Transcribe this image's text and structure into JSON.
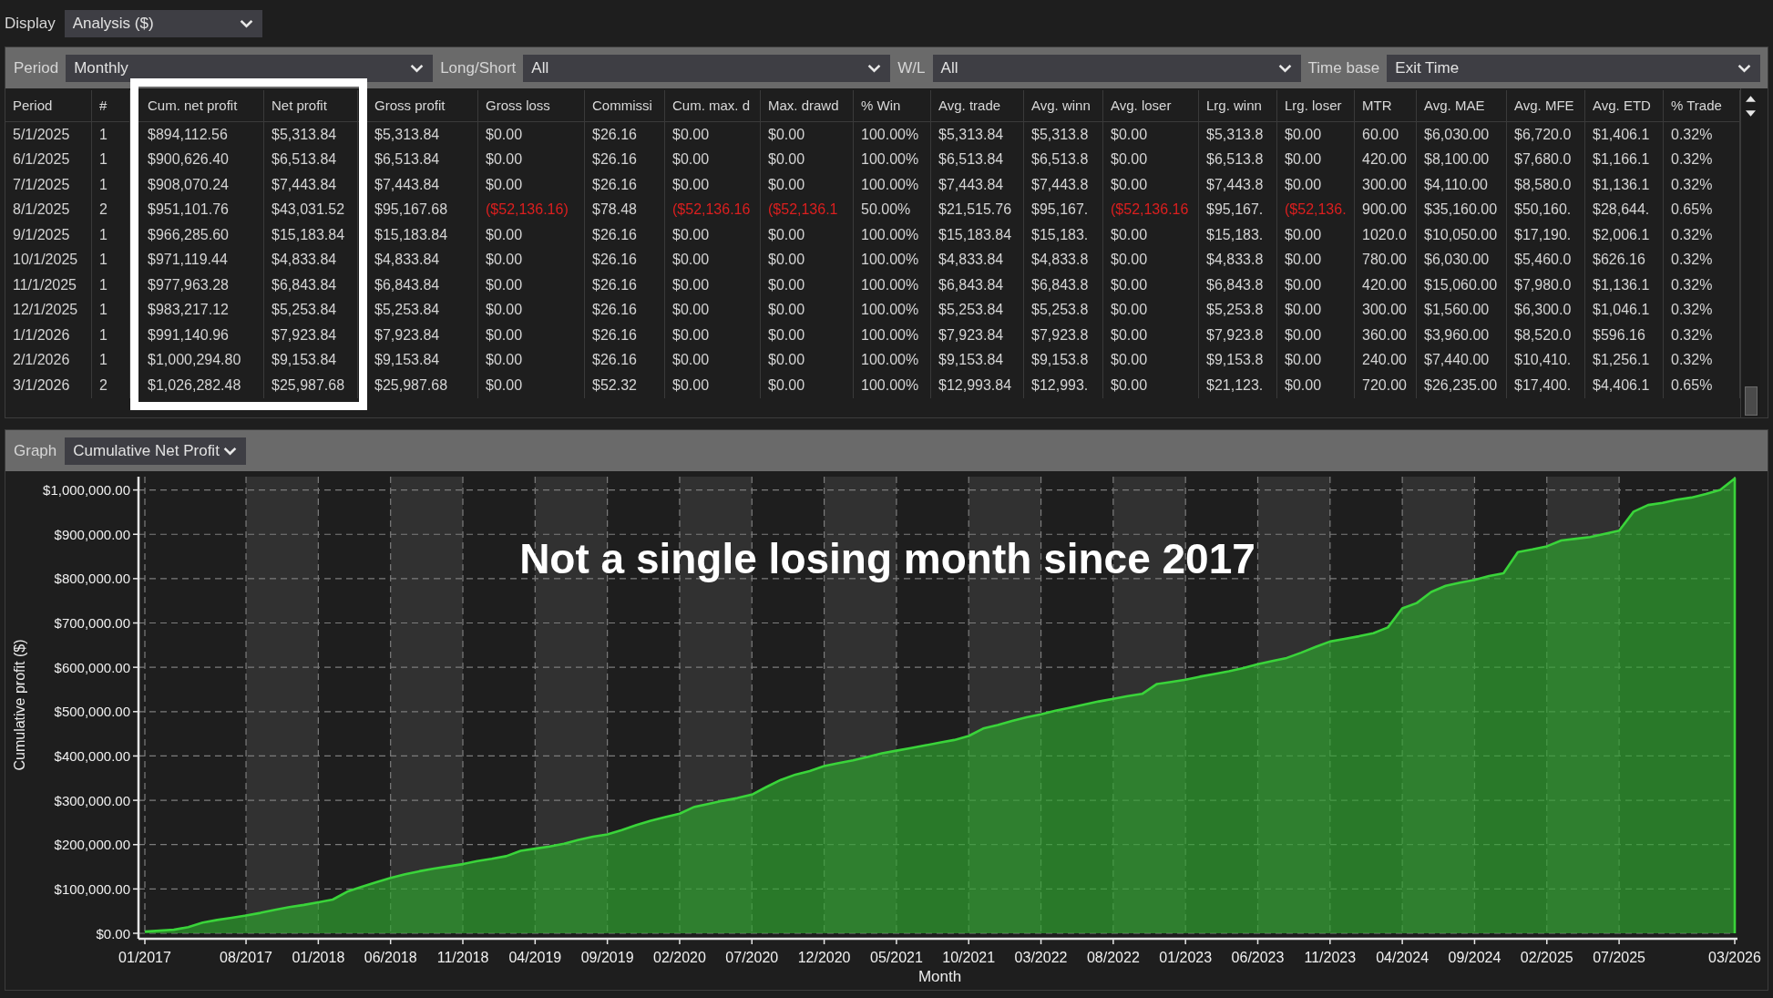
{
  "display": {
    "label": "Display",
    "value": "Analysis ($)"
  },
  "filters": [
    {
      "label": "Period",
      "value": "Monthly"
    },
    {
      "label": "Long/Short",
      "value": "All"
    },
    {
      "label": "W/L",
      "value": "All"
    },
    {
      "label": "Time base",
      "value": "Exit Time"
    }
  ],
  "table": {
    "columns": [
      {
        "label": "Period",
        "highlighted": false
      },
      {
        "label": "#",
        "highlighted": false
      },
      {
        "label": "Cum. net profit",
        "highlighted": true
      },
      {
        "label": "Net profit",
        "highlighted": true
      },
      {
        "label": "Gross profit",
        "highlighted": false
      },
      {
        "label": "Gross loss",
        "highlighted": false
      },
      {
        "label": "Commissi",
        "highlighted": false
      },
      {
        "label": "Cum. max. d",
        "highlighted": false
      },
      {
        "label": "Max. drawd",
        "highlighted": false
      },
      {
        "label": "% Win",
        "highlighted": false
      },
      {
        "label": "Avg. trade",
        "highlighted": false
      },
      {
        "label": "Avg. winn",
        "highlighted": false
      },
      {
        "label": "Avg. loser",
        "highlighted": false
      },
      {
        "label": "Lrg. winn",
        "highlighted": false
      },
      {
        "label": "Lrg. loser",
        "highlighted": false
      },
      {
        "label": "MTR",
        "highlighted": false
      },
      {
        "label": "Avg. MAE",
        "highlighted": false
      },
      {
        "label": "Avg. MFE",
        "highlighted": false
      },
      {
        "label": "Avg. ETD",
        "highlighted": false
      },
      {
        "label": "% Trade",
        "highlighted": false
      }
    ],
    "rows": [
      {
        "cells": [
          {
            "text": "5/1/2025",
            "negative": false
          },
          {
            "text": "1",
            "negative": false
          },
          {
            "text": "$894,112.56",
            "negative": false
          },
          {
            "text": "$5,313.84",
            "negative": false
          },
          {
            "text": "$5,313.84",
            "negative": false
          },
          {
            "text": "$0.00",
            "negative": false
          },
          {
            "text": "$26.16",
            "negative": false
          },
          {
            "text": "$0.00",
            "negative": false
          },
          {
            "text": "$0.00",
            "negative": false
          },
          {
            "text": "100.00%",
            "negative": false
          },
          {
            "text": "$5,313.84",
            "negative": false
          },
          {
            "text": "$5,313.8",
            "negative": false
          },
          {
            "text": "$0.00",
            "negative": false
          },
          {
            "text": "$5,313.8",
            "negative": false
          },
          {
            "text": "$0.00",
            "negative": false
          },
          {
            "text": "60.00",
            "negative": false
          },
          {
            "text": "$6,030.00",
            "negative": false
          },
          {
            "text": "$6,720.0",
            "negative": false
          },
          {
            "text": "$1,406.1",
            "negative": false
          },
          {
            "text": "0.32%",
            "negative": false
          }
        ]
      },
      {
        "cells": [
          {
            "text": "6/1/2025",
            "negative": false
          },
          {
            "text": "1",
            "negative": false
          },
          {
            "text": "$900,626.40",
            "negative": false
          },
          {
            "text": "$6,513.84",
            "negative": false
          },
          {
            "text": "$6,513.84",
            "negative": false
          },
          {
            "text": "$0.00",
            "negative": false
          },
          {
            "text": "$26.16",
            "negative": false
          },
          {
            "text": "$0.00",
            "negative": false
          },
          {
            "text": "$0.00",
            "negative": false
          },
          {
            "text": "100.00%",
            "negative": false
          },
          {
            "text": "$6,513.84",
            "negative": false
          },
          {
            "text": "$6,513.8",
            "negative": false
          },
          {
            "text": "$0.00",
            "negative": false
          },
          {
            "text": "$6,513.8",
            "negative": false
          },
          {
            "text": "$0.00",
            "negative": false
          },
          {
            "text": "420.00",
            "negative": false
          },
          {
            "text": "$8,100.00",
            "negative": false
          },
          {
            "text": "$7,680.0",
            "negative": false
          },
          {
            "text": "$1,166.1",
            "negative": false
          },
          {
            "text": "0.32%",
            "negative": false
          }
        ]
      },
      {
        "cells": [
          {
            "text": "7/1/2025",
            "negative": false
          },
          {
            "text": "1",
            "negative": false
          },
          {
            "text": "$908,070.24",
            "negative": false
          },
          {
            "text": "$7,443.84",
            "negative": false
          },
          {
            "text": "$7,443.84",
            "negative": false
          },
          {
            "text": "$0.00",
            "negative": false
          },
          {
            "text": "$26.16",
            "negative": false
          },
          {
            "text": "$0.00",
            "negative": false
          },
          {
            "text": "$0.00",
            "negative": false
          },
          {
            "text": "100.00%",
            "negative": false
          },
          {
            "text": "$7,443.84",
            "negative": false
          },
          {
            "text": "$7,443.8",
            "negative": false
          },
          {
            "text": "$0.00",
            "negative": false
          },
          {
            "text": "$7,443.8",
            "negative": false
          },
          {
            "text": "$0.00",
            "negative": false
          },
          {
            "text": "300.00",
            "negative": false
          },
          {
            "text": "$4,110.00",
            "negative": false
          },
          {
            "text": "$8,580.0",
            "negative": false
          },
          {
            "text": "$1,136.1",
            "negative": false
          },
          {
            "text": "0.32%",
            "negative": false
          }
        ]
      },
      {
        "cells": [
          {
            "text": "8/1/2025",
            "negative": false
          },
          {
            "text": "2",
            "negative": false
          },
          {
            "text": "$951,101.76",
            "negative": false
          },
          {
            "text": "$43,031.52",
            "negative": false
          },
          {
            "text": "$95,167.68",
            "negative": false
          },
          {
            "text": "($52,136.16)",
            "negative": true
          },
          {
            "text": "$78.48",
            "negative": false
          },
          {
            "text": "($52,136.16",
            "negative": true
          },
          {
            "text": "($52,136.1",
            "negative": true
          },
          {
            "text": "50.00%",
            "negative": false
          },
          {
            "text": "$21,515.76",
            "negative": false
          },
          {
            "text": "$95,167.",
            "negative": false
          },
          {
            "text": "($52,136.16",
            "negative": true
          },
          {
            "text": "$95,167.",
            "negative": false
          },
          {
            "text": "($52,136.",
            "negative": true
          },
          {
            "text": "900.00",
            "negative": false
          },
          {
            "text": "$35,160.00",
            "negative": false
          },
          {
            "text": "$50,160.",
            "negative": false
          },
          {
            "text": "$28,644.",
            "negative": false
          },
          {
            "text": "0.65%",
            "negative": false
          }
        ]
      },
      {
        "cells": [
          {
            "text": "9/1/2025",
            "negative": false
          },
          {
            "text": "1",
            "negative": false
          },
          {
            "text": "$966,285.60",
            "negative": false
          },
          {
            "text": "$15,183.84",
            "negative": false
          },
          {
            "text": "$15,183.84",
            "negative": false
          },
          {
            "text": "$0.00",
            "negative": false
          },
          {
            "text": "$26.16",
            "negative": false
          },
          {
            "text": "$0.00",
            "negative": false
          },
          {
            "text": "$0.00",
            "negative": false
          },
          {
            "text": "100.00%",
            "negative": false
          },
          {
            "text": "$15,183.84",
            "negative": false
          },
          {
            "text": "$15,183.",
            "negative": false
          },
          {
            "text": "$0.00",
            "negative": false
          },
          {
            "text": "$15,183.",
            "negative": false
          },
          {
            "text": "$0.00",
            "negative": false
          },
          {
            "text": "1020.0",
            "negative": false
          },
          {
            "text": "$10,050.00",
            "negative": false
          },
          {
            "text": "$17,190.",
            "negative": false
          },
          {
            "text": "$2,006.1",
            "negative": false
          },
          {
            "text": "0.32%",
            "negative": false
          }
        ]
      },
      {
        "cells": [
          {
            "text": "10/1/2025",
            "negative": false
          },
          {
            "text": "1",
            "negative": false
          },
          {
            "text": "$971,119.44",
            "negative": false
          },
          {
            "text": "$4,833.84",
            "negative": false
          },
          {
            "text": "$4,833.84",
            "negative": false
          },
          {
            "text": "$0.00",
            "negative": false
          },
          {
            "text": "$26.16",
            "negative": false
          },
          {
            "text": "$0.00",
            "negative": false
          },
          {
            "text": "$0.00",
            "negative": false
          },
          {
            "text": "100.00%",
            "negative": false
          },
          {
            "text": "$4,833.84",
            "negative": false
          },
          {
            "text": "$4,833.8",
            "negative": false
          },
          {
            "text": "$0.00",
            "negative": false
          },
          {
            "text": "$4,833.8",
            "negative": false
          },
          {
            "text": "$0.00",
            "negative": false
          },
          {
            "text": "780.00",
            "negative": false
          },
          {
            "text": "$6,030.00",
            "negative": false
          },
          {
            "text": "$5,460.0",
            "negative": false
          },
          {
            "text": "$626.16",
            "negative": false
          },
          {
            "text": "0.32%",
            "negative": false
          }
        ]
      },
      {
        "cells": [
          {
            "text": "11/1/2025",
            "negative": false
          },
          {
            "text": "1",
            "negative": false
          },
          {
            "text": "$977,963.28",
            "negative": false
          },
          {
            "text": "$6,843.84",
            "negative": false
          },
          {
            "text": "$6,843.84",
            "negative": false
          },
          {
            "text": "$0.00",
            "negative": false
          },
          {
            "text": "$26.16",
            "negative": false
          },
          {
            "text": "$0.00",
            "negative": false
          },
          {
            "text": "$0.00",
            "negative": false
          },
          {
            "text": "100.00%",
            "negative": false
          },
          {
            "text": "$6,843.84",
            "negative": false
          },
          {
            "text": "$6,843.8",
            "negative": false
          },
          {
            "text": "$0.00",
            "negative": false
          },
          {
            "text": "$6,843.8",
            "negative": false
          },
          {
            "text": "$0.00",
            "negative": false
          },
          {
            "text": "420.00",
            "negative": false
          },
          {
            "text": "$15,060.00",
            "negative": false
          },
          {
            "text": "$7,980.0",
            "negative": false
          },
          {
            "text": "$1,136.1",
            "negative": false
          },
          {
            "text": "0.32%",
            "negative": false
          }
        ]
      },
      {
        "cells": [
          {
            "text": "12/1/2025",
            "negative": false
          },
          {
            "text": "1",
            "negative": false
          },
          {
            "text": "$983,217.12",
            "negative": false
          },
          {
            "text": "$5,253.84",
            "negative": false
          },
          {
            "text": "$5,253.84",
            "negative": false
          },
          {
            "text": "$0.00",
            "negative": false
          },
          {
            "text": "$26.16",
            "negative": false
          },
          {
            "text": "$0.00",
            "negative": false
          },
          {
            "text": "$0.00",
            "negative": false
          },
          {
            "text": "100.00%",
            "negative": false
          },
          {
            "text": "$5,253.84",
            "negative": false
          },
          {
            "text": "$5,253.8",
            "negative": false
          },
          {
            "text": "$0.00",
            "negative": false
          },
          {
            "text": "$5,253.8",
            "negative": false
          },
          {
            "text": "$0.00",
            "negative": false
          },
          {
            "text": "300.00",
            "negative": false
          },
          {
            "text": "$1,560.00",
            "negative": false
          },
          {
            "text": "$6,300.0",
            "negative": false
          },
          {
            "text": "$1,046.1",
            "negative": false
          },
          {
            "text": "0.32%",
            "negative": false
          }
        ]
      },
      {
        "cells": [
          {
            "text": "1/1/2026",
            "negative": false
          },
          {
            "text": "1",
            "negative": false
          },
          {
            "text": "$991,140.96",
            "negative": false
          },
          {
            "text": "$7,923.84",
            "negative": false
          },
          {
            "text": "$7,923.84",
            "negative": false
          },
          {
            "text": "$0.00",
            "negative": false
          },
          {
            "text": "$26.16",
            "negative": false
          },
          {
            "text": "$0.00",
            "negative": false
          },
          {
            "text": "$0.00",
            "negative": false
          },
          {
            "text": "100.00%",
            "negative": false
          },
          {
            "text": "$7,923.84",
            "negative": false
          },
          {
            "text": "$7,923.8",
            "negative": false
          },
          {
            "text": "$0.00",
            "negative": false
          },
          {
            "text": "$7,923.8",
            "negative": false
          },
          {
            "text": "$0.00",
            "negative": false
          },
          {
            "text": "360.00",
            "negative": false
          },
          {
            "text": "$3,960.00",
            "negative": false
          },
          {
            "text": "$8,520.0",
            "negative": false
          },
          {
            "text": "$596.16",
            "negative": false
          },
          {
            "text": "0.32%",
            "negative": false
          }
        ]
      },
      {
        "cells": [
          {
            "text": "2/1/2026",
            "negative": false
          },
          {
            "text": "1",
            "negative": false
          },
          {
            "text": "$1,000,294.80",
            "negative": false
          },
          {
            "text": "$9,153.84",
            "negative": false
          },
          {
            "text": "$9,153.84",
            "negative": false
          },
          {
            "text": "$0.00",
            "negative": false
          },
          {
            "text": "$26.16",
            "negative": false
          },
          {
            "text": "$0.00",
            "negative": false
          },
          {
            "text": "$0.00",
            "negative": false
          },
          {
            "text": "100.00%",
            "negative": false
          },
          {
            "text": "$9,153.84",
            "negative": false
          },
          {
            "text": "$9,153.8",
            "negative": false
          },
          {
            "text": "$0.00",
            "negative": false
          },
          {
            "text": "$9,153.8",
            "negative": false
          },
          {
            "text": "$0.00",
            "negative": false
          },
          {
            "text": "240.00",
            "negative": false
          },
          {
            "text": "$7,440.00",
            "negative": false
          },
          {
            "text": "$10,410.",
            "negative": false
          },
          {
            "text": "$1,256.1",
            "negative": false
          },
          {
            "text": "0.32%",
            "negative": false
          }
        ]
      },
      {
        "cells": [
          {
            "text": "3/1/2026",
            "negative": false
          },
          {
            "text": "2",
            "negative": false
          },
          {
            "text": "$1,026,282.48",
            "negative": false
          },
          {
            "text": "$25,987.68",
            "negative": false
          },
          {
            "text": "$25,987.68",
            "negative": false
          },
          {
            "text": "$0.00",
            "negative": false
          },
          {
            "text": "$52.32",
            "negative": false
          },
          {
            "text": "$0.00",
            "negative": false
          },
          {
            "text": "$0.00",
            "negative": false
          },
          {
            "text": "100.00%",
            "negative": false
          },
          {
            "text": "$12,993.84",
            "negative": false
          },
          {
            "text": "$12,993.",
            "negative": false
          },
          {
            "text": "$0.00",
            "negative": false
          },
          {
            "text": "$21,123.",
            "negative": false
          },
          {
            "text": "$0.00",
            "negative": false
          },
          {
            "text": "720.00",
            "negative": false
          },
          {
            "text": "$26,235.00",
            "negative": false
          },
          {
            "text": "$17,400.",
            "negative": false
          },
          {
            "text": "$4,406.1",
            "negative": false
          },
          {
            "text": "0.65%",
            "negative": false
          }
        ]
      }
    ]
  },
  "graph": {
    "label": "Graph",
    "value": "Cumulative Net Profit",
    "chart_data": {
      "type": "area",
      "xlabel": "Month",
      "ylabel": "Cumulative profit ($)",
      "categories": [
        "01/2017",
        null,
        null,
        null,
        null,
        null,
        null,
        "08/2017",
        null,
        null,
        null,
        null,
        "01/2018",
        null,
        null,
        null,
        null,
        "06/2018",
        null,
        null,
        null,
        null,
        "11/2018",
        null,
        null,
        null,
        null,
        "04/2019",
        null,
        null,
        null,
        null,
        "09/2019",
        null,
        null,
        null,
        null,
        "02/2020",
        null,
        null,
        null,
        null,
        "07/2020",
        null,
        null,
        null,
        null,
        "12/2020",
        null,
        null,
        null,
        null,
        "05/2021",
        null,
        null,
        null,
        null,
        "10/2021",
        null,
        null,
        null,
        null,
        "03/2022",
        null,
        null,
        null,
        null,
        "08/2022",
        null,
        null,
        null,
        null,
        "01/2023",
        null,
        null,
        null,
        null,
        "06/2023",
        null,
        null,
        null,
        null,
        "11/2023",
        null,
        null,
        null,
        null,
        "04/2024",
        null,
        null,
        null,
        null,
        "09/2024",
        null,
        null,
        null,
        null,
        "02/2025",
        null,
        null,
        null,
        null,
        "07/2025",
        null,
        null,
        null,
        null,
        null,
        null,
        null,
        "03/2026"
      ],
      "values": [
        4000,
        6000,
        8000,
        14000,
        24000,
        30000,
        35000,
        40000,
        46000,
        53000,
        59000,
        64000,
        70000,
        76000,
        94000,
        105000,
        115000,
        125000,
        133000,
        140000,
        146000,
        151000,
        156000,
        163000,
        168000,
        174000,
        186000,
        191000,
        196000,
        202000,
        211000,
        218000,
        223000,
        233000,
        244000,
        254000,
        262000,
        270000,
        285000,
        292000,
        299000,
        305000,
        313000,
        330000,
        346000,
        358000,
        366000,
        377000,
        384000,
        390000,
        398000,
        406000,
        412000,
        418000,
        424000,
        430000,
        436000,
        445000,
        462000,
        470000,
        479000,
        487000,
        494000,
        502000,
        509000,
        516000,
        523000,
        529000,
        535000,
        540000,
        562000,
        567000,
        572000,
        579000,
        585000,
        591000,
        598000,
        607000,
        614000,
        621000,
        633000,
        646000,
        658000,
        664000,
        670000,
        677000,
        690000,
        733000,
        745000,
        770000,
        784000,
        791000,
        797000,
        806000,
        812000,
        860000,
        866000,
        873000,
        886000,
        890000,
        894000,
        901000,
        908000,
        951000,
        966000,
        971000,
        978000,
        983000,
        991000,
        1000000,
        1026000
      ],
      "ylim": [
        0,
        1030000
      ],
      "grid": true,
      "yticks": [
        {
          "value": 0,
          "label": "$0.00"
        },
        {
          "value": 100000,
          "label": "$100,000.00"
        },
        {
          "value": 200000,
          "label": "$200,000.00"
        },
        {
          "value": 300000,
          "label": "$300,000.00"
        },
        {
          "value": 400000,
          "label": "$400,000.00"
        },
        {
          "value": 500000,
          "label": "$500,000.00"
        },
        {
          "value": 600000,
          "label": "$600,000.00"
        },
        {
          "value": 700000,
          "label": "$700,000.00"
        },
        {
          "value": 800000,
          "label": "$800,000.00"
        },
        {
          "value": 900000,
          "label": "$900,000.00"
        },
        {
          "value": 1000000,
          "label": "$1,000,000.00"
        }
      ],
      "annotations": [
        "Not a single losing month since 2017"
      ]
    }
  }
}
